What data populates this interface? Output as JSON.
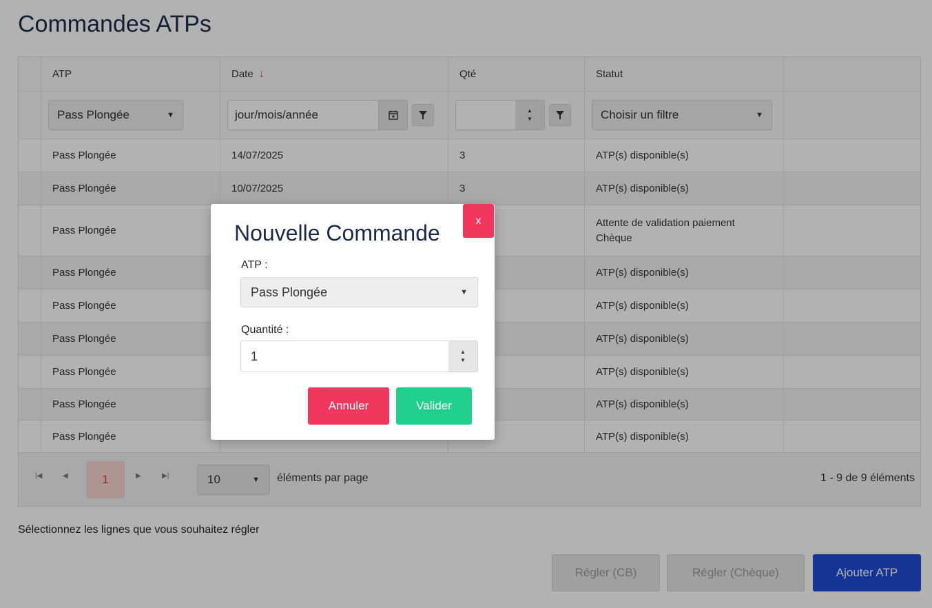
{
  "page": {
    "title": "Commandes ATPs"
  },
  "grid": {
    "columns": [
      "ATP",
      "Date",
      "Qté",
      "Statut"
    ],
    "filters": {
      "atp_value": "Pass Plongée",
      "date_placeholder": "jour/mois/année",
      "qty_value": "",
      "status_placeholder": "Choisir un filtre"
    },
    "rows": [
      {
        "atp": "Pass Plongée",
        "date": "14/07/2025",
        "qty": "3",
        "status": "ATP(s) disponible(s)"
      },
      {
        "atp": "Pass Plongée",
        "date": "10/07/2025",
        "qty": "3",
        "status": "ATP(s) disponible(s)"
      },
      {
        "atp": "Pass Plongée",
        "date": "",
        "qty": "",
        "status": "Attente de validation paiement Chèque"
      },
      {
        "atp": "Pass Plongée",
        "date": "",
        "qty": "",
        "status": "ATP(s) disponible(s)"
      },
      {
        "atp": "Pass Plongée",
        "date": "",
        "qty": "",
        "status": "ATP(s) disponible(s)"
      },
      {
        "atp": "Pass Plongée",
        "date": "",
        "qty": "",
        "status": "ATP(s) disponible(s)"
      },
      {
        "atp": "Pass Plongée",
        "date": "",
        "qty": "",
        "status": "ATP(s) disponible(s)"
      },
      {
        "atp": "Pass Plongée",
        "date": "",
        "qty": "",
        "status": "ATP(s) disponible(s)"
      },
      {
        "atp": "Pass Plongée",
        "date": "",
        "qty": "",
        "status": "ATP(s) disponible(s)"
      }
    ],
    "pager": {
      "current_page": "1",
      "page_size": "10",
      "page_size_label": "éléments par page",
      "count_label": "1 - 9 de 9 éléments"
    }
  },
  "hint": "Sélectionnez les lignes que vous souhaitez régler",
  "actions": {
    "pay_cb": "Régler (CB)",
    "pay_cheque": "Régler (Chèque)",
    "add_atp": "Ajouter ATP"
  },
  "modal": {
    "title": "Nouvelle Commande",
    "close_label": "x",
    "atp_label": "ATP :",
    "atp_value": "Pass Plongée",
    "qty_label": "Quantité :",
    "qty_value": "1",
    "cancel_label": "Annuler",
    "ok_label": "Valider"
  },
  "colors": {
    "primary": "#1e4cd7",
    "danger": "#f2375e",
    "success": "#1fcf8b",
    "sort_arrow": "#e53935"
  }
}
